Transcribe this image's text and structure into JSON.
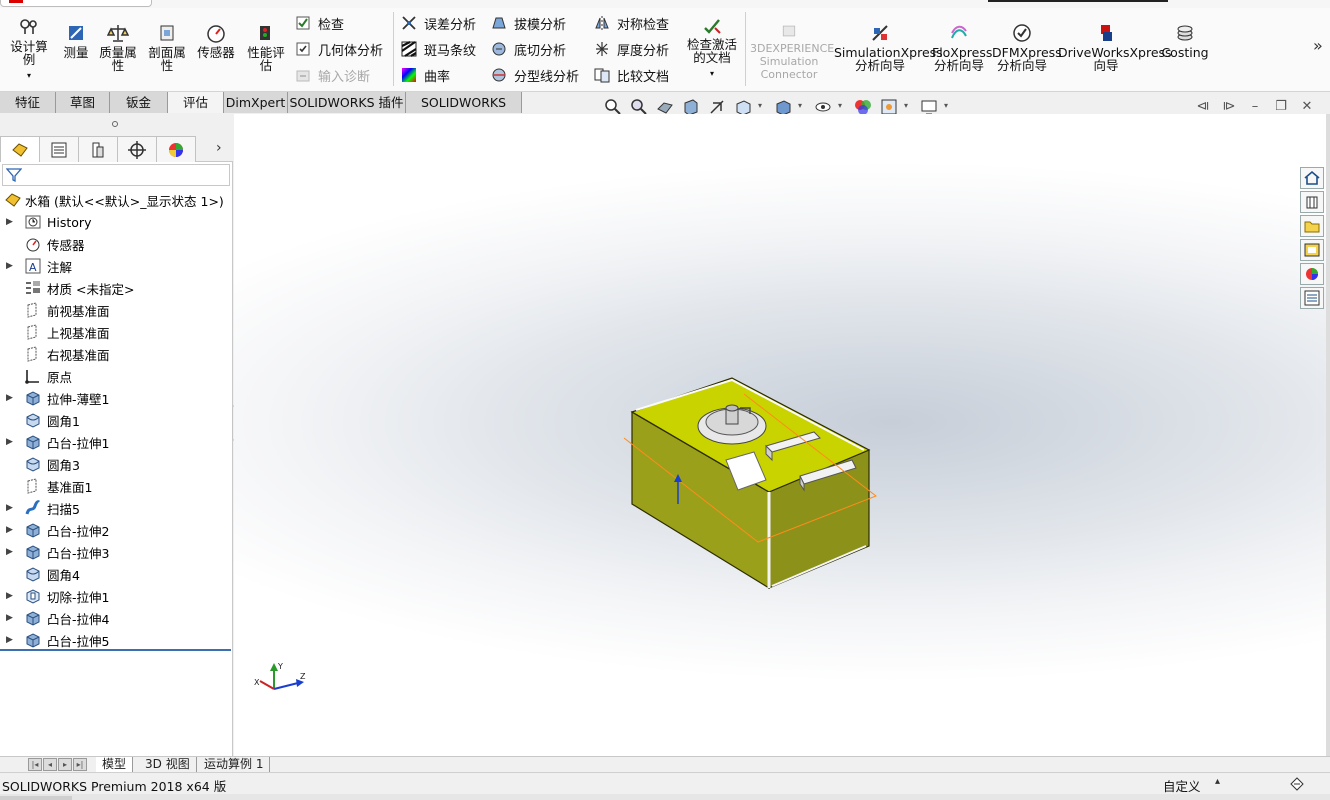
{
  "ribbon": {
    "design_study": "设计算例",
    "measure": "测量",
    "mass_properties": "质量属性",
    "section_properties": "剖面属性",
    "sensor": "传感器",
    "performance_eval": "性能评估",
    "check": "检查",
    "geometry_analysis": "几何体分析",
    "import_diagnostics": "输入诊断",
    "deviation_analysis": "误差分析",
    "zebra_stripes": "斑马条纹",
    "curvature": "曲率",
    "draft_analysis": "拔模分析",
    "undercut_analysis": "底切分析",
    "parting_line_analysis": "分型线分析",
    "symmetry_check": "对称检查",
    "thickness_analysis": "厚度分析",
    "compare_documents": "比较文档",
    "check_active_doc": "检查激活的文档",
    "connector": "3DEXPERIENCE Simulation Connector",
    "simulationxpress": "SimulationXpress 分析向导",
    "floxpress": "FloXpress 分析向导",
    "dfmxpress": "DFMXpress 分析向导",
    "driveworksxpress": "DriveWorksXpress 向导",
    "costing": "Costing",
    "more": "»"
  },
  "tabs": [
    "特征",
    "草图",
    "钣金",
    "评估",
    "DimXpert",
    "SOLIDWORKS 插件",
    "SOLIDWORKS MBD"
  ],
  "active_tab": "评估",
  "tree": {
    "root": "水箱 (默认<<默认>_显示状态 1>)",
    "items": [
      {
        "label": "History",
        "icon": "history-icon",
        "expand": true
      },
      {
        "label": "传感器",
        "icon": "sensor-icon",
        "expand": false
      },
      {
        "label": "注解",
        "icon": "annotation-icon",
        "expand": true
      },
      {
        "label": "材质 <未指定>",
        "icon": "material-icon",
        "expand": false
      },
      {
        "label": "前视基准面",
        "icon": "plane-icon",
        "expand": false
      },
      {
        "label": "上视基准面",
        "icon": "plane-icon",
        "expand": false
      },
      {
        "label": "右视基准面",
        "icon": "plane-icon",
        "expand": false
      },
      {
        "label": "原点",
        "icon": "origin-icon",
        "expand": false
      },
      {
        "label": "拉伸-薄壁1",
        "icon": "extrude-icon",
        "expand": true
      },
      {
        "label": "圆角1",
        "icon": "fillet-icon",
        "expand": false
      },
      {
        "label": "凸台-拉伸1",
        "icon": "extrude-icon",
        "expand": true
      },
      {
        "label": "圆角3",
        "icon": "fillet-icon",
        "expand": false
      },
      {
        "label": "基准面1",
        "icon": "plane-icon",
        "expand": false
      },
      {
        "label": "扫描5",
        "icon": "sweep-icon",
        "expand": true
      },
      {
        "label": "凸台-拉伸2",
        "icon": "extrude-icon",
        "expand": true
      },
      {
        "label": "凸台-拉伸3",
        "icon": "extrude-icon",
        "expand": true
      },
      {
        "label": "圆角4",
        "icon": "fillet-icon",
        "expand": false
      },
      {
        "label": "切除-拉伸1",
        "icon": "cut-extrude-icon",
        "expand": true
      },
      {
        "label": "凸台-拉伸4",
        "icon": "extrude-icon",
        "expand": true
      },
      {
        "label": "凸台-拉伸5",
        "icon": "extrude-icon",
        "expand": true
      }
    ]
  },
  "bottom_tabs": [
    "模型",
    "3D 视图",
    "运动算例 1"
  ],
  "active_bottom_tab": "模型",
  "status": {
    "product": "SOLIDWORKS Premium 2018 x64 版",
    "units": "自定义"
  },
  "colors": {
    "model_face": "#c9d300",
    "model_side": "#9aa01a",
    "selection": "#ff8c1a"
  }
}
